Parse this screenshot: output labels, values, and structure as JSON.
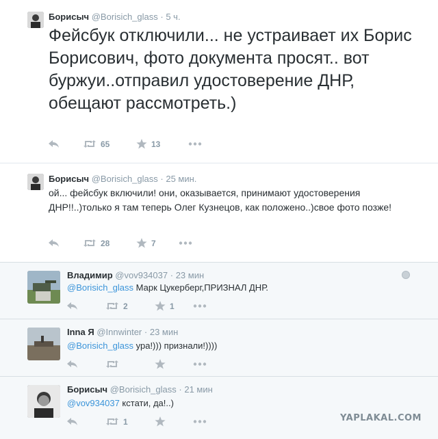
{
  "tweets": [
    {
      "name": "Борисыч",
      "handle": "@Borisich_glass",
      "dot": "·",
      "time": "5 ч.",
      "text": "Фейсбук отключили... не устраивает их Борис Борисович, фото документа просят.. вот буржуи..отправил удостоверение ДНР, обещают рассмотреть.)",
      "retweets": "65",
      "favorites": "13"
    },
    {
      "name": "Борисыч",
      "handle": "@Borisich_glass",
      "dot": "·",
      "time": "25 мин.",
      "text": "ой... фейсбук включили! они, оказывается, принимают удостоверения ДНР!!..)только я там теперь Олег Кузнецов, как положено..)свое фото позже!",
      "retweets": "28",
      "favorites": "7"
    }
  ],
  "replies": [
    {
      "name": "Владимир",
      "handle": "@vov934037",
      "dot": "·",
      "time": "23 мин",
      "mention": "@Borisich_glass",
      "text": " Марк Цукерберг,ПРИЗНАЛ ДНР.",
      "retweets": "2",
      "favorites": "1"
    },
    {
      "name": "Inna Я",
      "handle": "@Innwinter",
      "dot": "·",
      "time": "23 мин",
      "mention": "@Borisich_glass",
      "text": " ура!))) признали!))))",
      "retweets": "",
      "favorites": ""
    },
    {
      "name": "Борисыч",
      "handle": "@Borisich_glass",
      "dot": "·",
      "time": "21 мин",
      "mention": "@vov934037",
      "text": " кстати, да!..)",
      "retweets": "1",
      "favorites": ""
    }
  ],
  "watermark": "YAPLAKAL.COM",
  "icons": {
    "reply": "reply-icon",
    "retweet": "retweet-icon",
    "favorite": "star-icon",
    "more": "more-icon",
    "settings": "gear-icon"
  },
  "colors": {
    "link": "#3b94d9",
    "meta": "#8899a6",
    "action": "#b0b8bf",
    "panel": "#f5f8fa"
  }
}
